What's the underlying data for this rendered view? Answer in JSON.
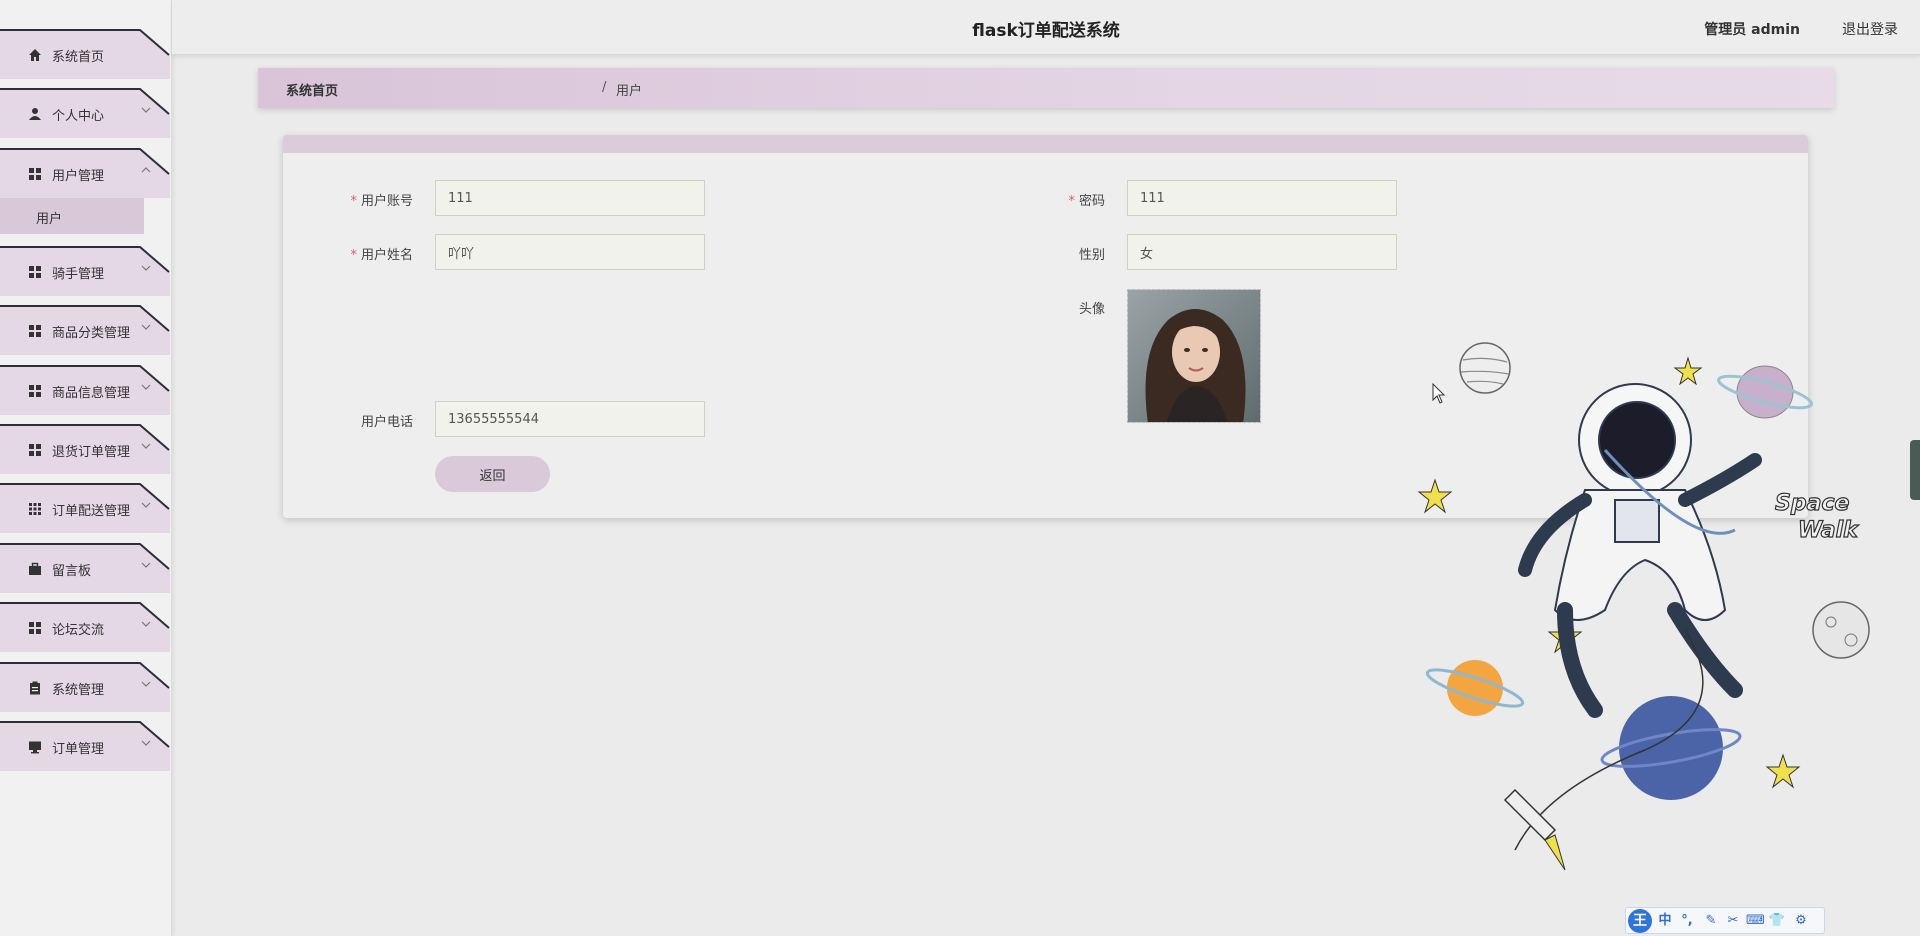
{
  "header": {
    "title": "flask订单配送系统",
    "user": "管理员 admin",
    "logout": "退出登录"
  },
  "sidebar": {
    "items": [
      {
        "label": "系统首页",
        "icon": "home-icon",
        "chevron": false
      },
      {
        "label": "个人中心",
        "icon": "user-icon",
        "chevron": true
      },
      {
        "label": "用户管理",
        "icon": "grid-icon",
        "chevron": true,
        "expanded": true
      },
      {
        "label": "骑手管理",
        "icon": "grid-icon",
        "chevron": true
      },
      {
        "label": "商品分类管理",
        "icon": "grid-icon",
        "chevron": true
      },
      {
        "label": "商品信息管理",
        "icon": "grid-icon",
        "chevron": true
      },
      {
        "label": "退货订单管理",
        "icon": "grid-icon",
        "chevron": true
      },
      {
        "label": "订单配送管理",
        "icon": "apps-icon",
        "chevron": true
      },
      {
        "label": "留言板",
        "icon": "briefcase-icon",
        "chevron": true
      },
      {
        "label": "论坛交流",
        "icon": "grid-icon",
        "chevron": true
      },
      {
        "label": "系统管理",
        "icon": "clipboard-icon",
        "chevron": true
      },
      {
        "label": "订单管理",
        "icon": "monitor-icon",
        "chevron": true
      }
    ],
    "submenu": {
      "label": "用户"
    }
  },
  "breadcrumb": {
    "home": "系统首页",
    "separator": "/",
    "current": "用户"
  },
  "form": {
    "account": {
      "label": "用户账号",
      "value": "111",
      "required": true
    },
    "password": {
      "label": "密码",
      "value": "111",
      "required": true
    },
    "name": {
      "label": "用户姓名",
      "value": "吖吖",
      "required": true
    },
    "gender": {
      "label": "性别",
      "value": "女",
      "required": false
    },
    "avatar": {
      "label": "头像"
    },
    "phone": {
      "label": "用户电话",
      "value": "13655555544",
      "required": false
    },
    "back_label": "返回"
  },
  "ime": {
    "logo": "王",
    "items": [
      "中",
      "°,",
      "✎",
      "✂",
      "⌨",
      "👕",
      "⚙"
    ]
  },
  "colors": {
    "accent": "#dac9d9",
    "required": "#e45a5a",
    "ime_blue": "#2f74d6"
  }
}
